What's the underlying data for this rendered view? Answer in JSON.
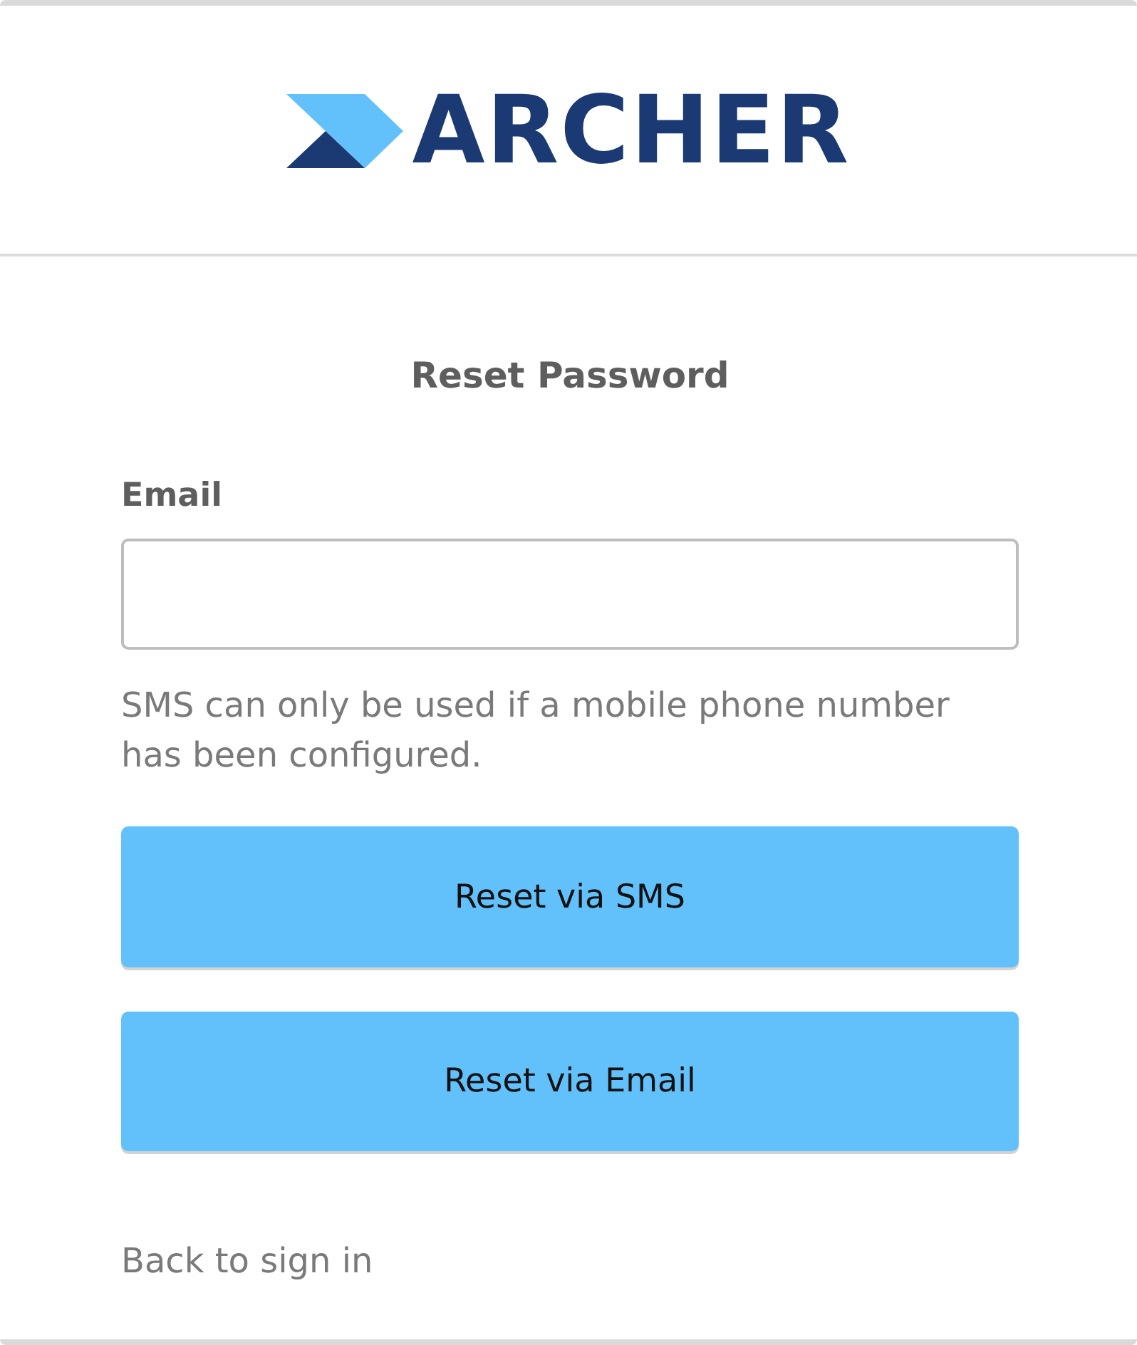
{
  "logo": {
    "text": "ARCHER"
  },
  "title": "Reset Password",
  "email_field": {
    "label": "Email"
  },
  "help_text": "SMS can only be used if a mobile phone number has been configured.",
  "buttons": [
    {
      "label": "Reset via SMS"
    },
    {
      "label": "Reset via Email"
    }
  ],
  "back_link": "Back to sign in"
}
